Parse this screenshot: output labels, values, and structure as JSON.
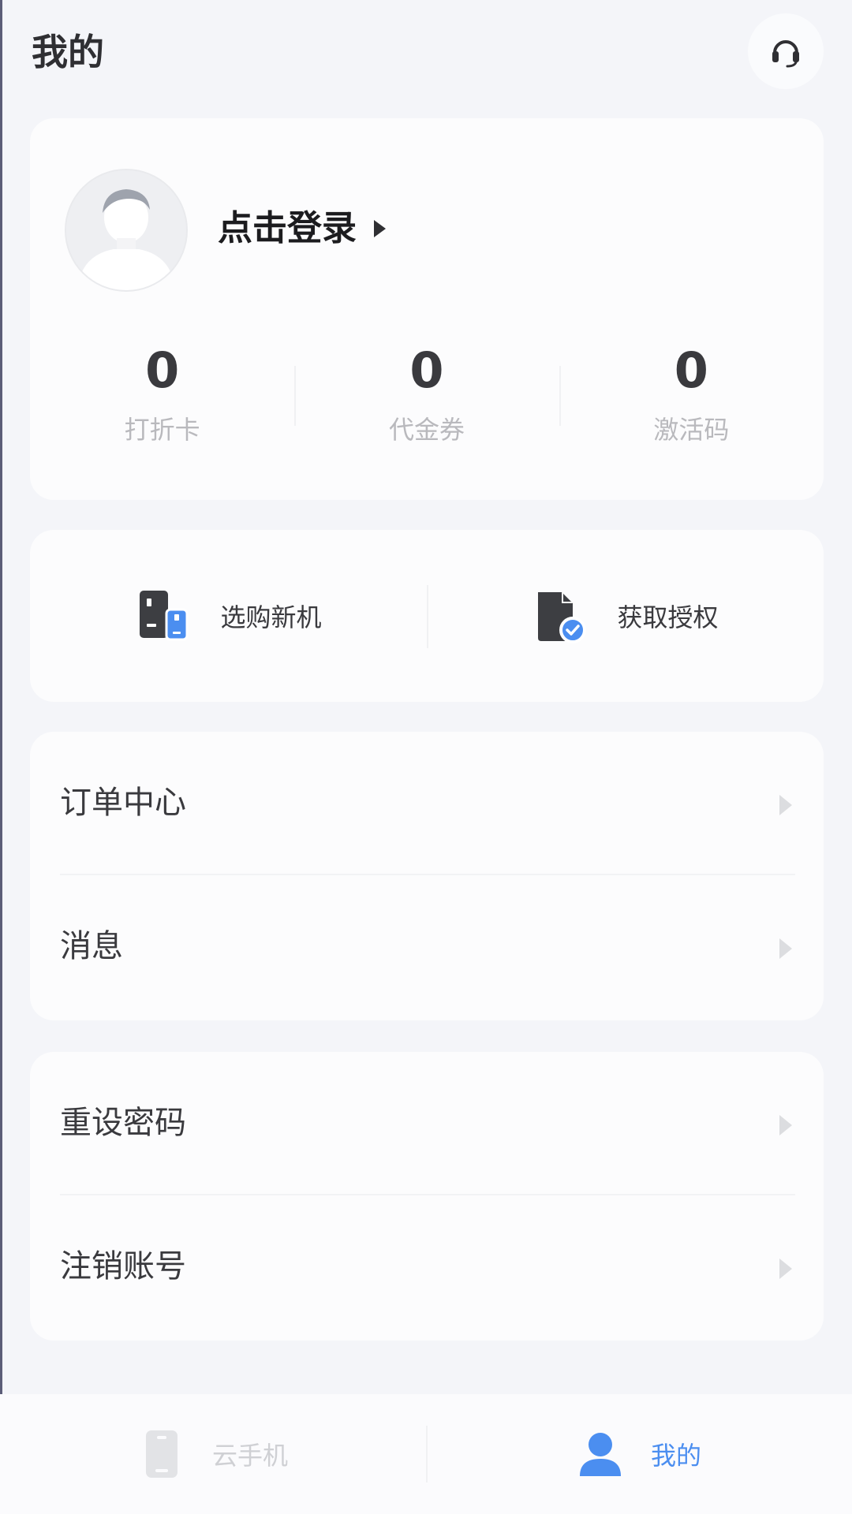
{
  "header": {
    "title": "我的",
    "service_icon": "headset-icon"
  },
  "profile": {
    "login_label": "点击登录",
    "stats": [
      {
        "value": "0",
        "label": "打折卡"
      },
      {
        "value": "0",
        "label": "代金券"
      },
      {
        "value": "0",
        "label": "激活码"
      }
    ]
  },
  "quick_actions": [
    {
      "label": "选购新机",
      "icon": "phones-icon"
    },
    {
      "label": "获取授权",
      "icon": "document-check-icon"
    }
  ],
  "menu_groups": [
    {
      "items": [
        {
          "label": "订单中心"
        },
        {
          "label": "消息"
        }
      ]
    },
    {
      "items": [
        {
          "label": "重设密码"
        },
        {
          "label": "注销账号"
        }
      ]
    }
  ],
  "tabbar": {
    "tabs": [
      {
        "label": "云手机",
        "icon": "phone-icon",
        "active": false
      },
      {
        "label": "我的",
        "icon": "user-icon",
        "active": true
      }
    ]
  },
  "colors": {
    "background": "#f4f5f9",
    "card": "#fcfcfd",
    "accent": "#4b8ef0",
    "text": "#3a3a3e",
    "muted": "#b9b9bd"
  }
}
